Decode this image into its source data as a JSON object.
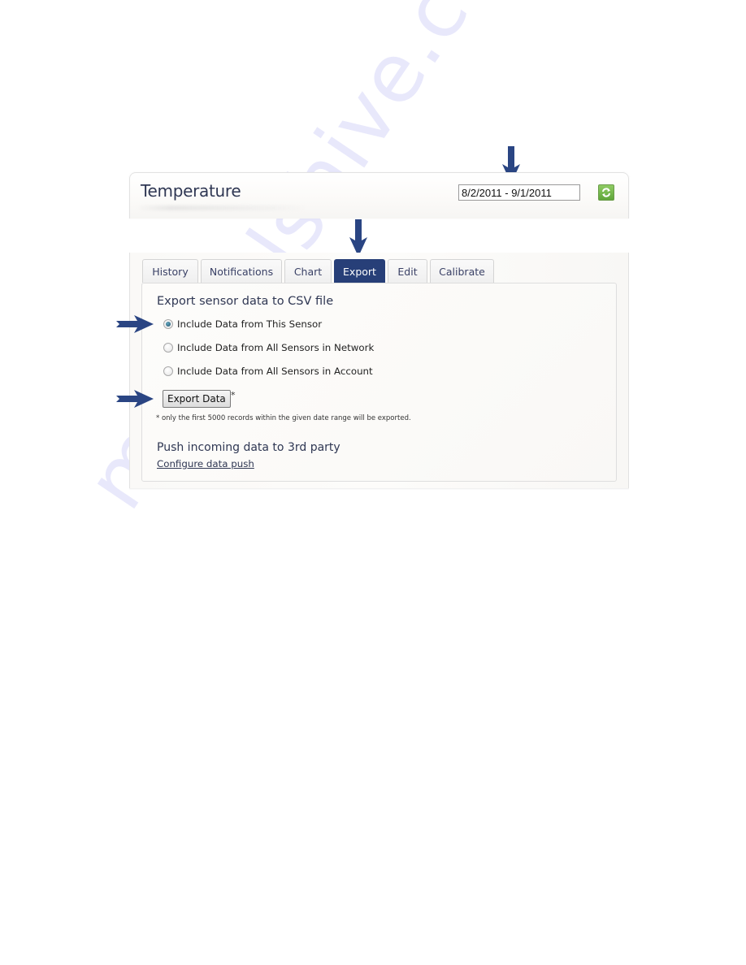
{
  "header": {
    "title": "Temperature",
    "date_range_value": "8/2/2011 - 9/1/2011",
    "refresh_icon": "refresh-icon"
  },
  "tabs": [
    {
      "label": "History",
      "active": false
    },
    {
      "label": "Notifications",
      "active": false
    },
    {
      "label": "Chart",
      "active": false
    },
    {
      "label": "Export",
      "active": true
    },
    {
      "label": "Edit",
      "active": false
    },
    {
      "label": "Calibrate",
      "active": false
    }
  ],
  "export": {
    "section_title": "Export sensor data to CSV file",
    "options": [
      {
        "label": "Include Data from This Sensor",
        "selected": true
      },
      {
        "label": "Include Data from All Sensors in Network",
        "selected": false
      },
      {
        "label": "Include Data from All Sensors in Account",
        "selected": false
      }
    ],
    "button_label": "Export Data",
    "asterisk": "*",
    "footnote": "* only the first 5000 records within the given date range will be exported."
  },
  "push": {
    "section_title": "Push incoming data to 3rd party",
    "link_label": "Configure data push"
  },
  "annotations": {
    "arrow_color": "#2a4583",
    "arrows": [
      "date-range-arrow",
      "export-tab-arrow",
      "this-sensor-option-arrow",
      "export-button-arrow"
    ]
  },
  "watermark": "manualshive.com"
}
